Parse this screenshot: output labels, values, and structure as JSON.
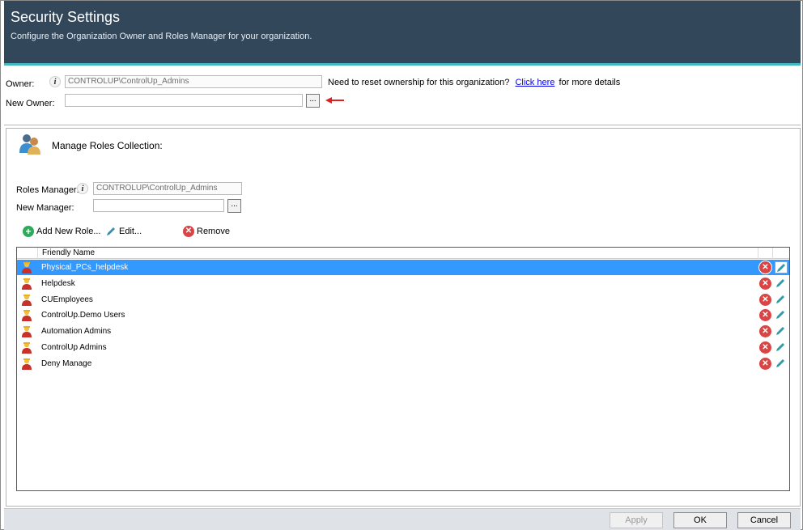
{
  "header": {
    "title": "Security Settings",
    "subtitle": "Configure the Organization Owner and Roles Manager for your organization."
  },
  "owner": {
    "owner_label": "Owner:",
    "owner_value": "CONTROLUP\\ControlUp_Admins",
    "reset_text": "Need to reset ownership for this organization?",
    "reset_link": "Click here",
    "reset_suffix": "for more details",
    "new_owner_label": "New Owner:",
    "new_owner_value": "",
    "browse_label": "..."
  },
  "roles": {
    "section_title": "Manage Roles Collection:",
    "manager_label": "Roles Manager:",
    "manager_value": "CONTROLUP\\ControlUp_Admins",
    "new_manager_label": "New Manager:",
    "new_manager_value": "",
    "browse_label": "...",
    "toolbar": {
      "add_label": "Add New Role...",
      "edit_label": "Edit...",
      "remove_label": "Remove"
    },
    "grid": {
      "column_header": "Friendly Name",
      "rows": [
        {
          "name": "Physical_PCs_helpdesk",
          "selected": true
        },
        {
          "name": "Helpdesk"
        },
        {
          "name": "CUEmployees"
        },
        {
          "name": "ControlUp.Demo Users"
        },
        {
          "name": "Automation Admins"
        },
        {
          "name": "ControlUp Admins"
        },
        {
          "name": "Deny Manage"
        }
      ]
    }
  },
  "footer": {
    "apply_label": "Apply",
    "ok_label": "OK",
    "cancel_label": "Cancel"
  },
  "colors": {
    "header_bg": "#33475b",
    "header_accent": "#3fb8c4",
    "selection": "#3399ff",
    "remove_red": "#d94545",
    "add_green": "#2eaa5a",
    "link": "#0000ee"
  },
  "icons": {
    "info": "info-icon",
    "browse": "ellipsis-icon",
    "arrow": "red-arrow-icon",
    "roles_section": "users-icon",
    "row_user": "user-icon",
    "add": "plus-circle-icon",
    "edit": "pencil-icon",
    "remove": "x-circle-icon"
  }
}
